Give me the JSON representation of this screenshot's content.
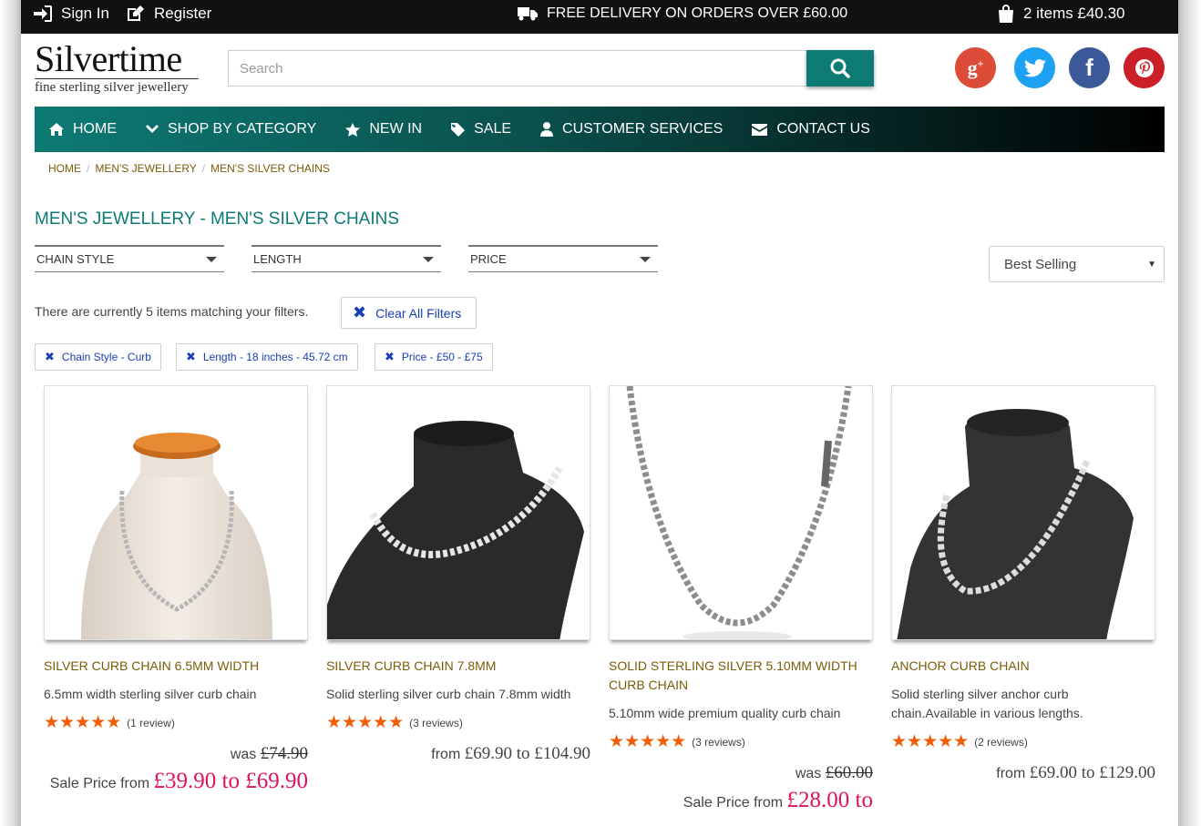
{
  "topbar": {
    "sign_in": "Sign In",
    "register": "Register",
    "delivery": "FREE DELIVERY ON ORDERS OVER £60.00",
    "cart": "2 items £40.30"
  },
  "header": {
    "brand": "Silvertime",
    "tagline": "fine sterling silver jewellery",
    "search_placeholder": "Search"
  },
  "social": [
    "google-plus",
    "twitter",
    "facebook",
    "pinterest"
  ],
  "nav": [
    {
      "label": "HOME",
      "icon": "home-icon"
    },
    {
      "label": "SHOP BY CATEGORY",
      "icon": "chevron-down-icon"
    },
    {
      "label": "NEW IN",
      "icon": "star-icon"
    },
    {
      "label": "SALE",
      "icon": "tag-icon"
    },
    {
      "label": "CUSTOMER SERVICES",
      "icon": "user-icon"
    },
    {
      "label": "CONTACT US",
      "icon": "envelope-icon"
    }
  ],
  "breadcrumb": [
    "HOME",
    "MEN'S JEWELLERY",
    "MEN'S SILVER CHAINS"
  ],
  "page_title": "MEN'S JEWELLERY - MEN'S SILVER CHAINS",
  "filters": [
    "CHAIN STYLE",
    "LENGTH",
    "PRICE"
  ],
  "sort": {
    "selected": "Best Selling"
  },
  "match_text": "There are currently 5 items matching your filters.",
  "clear_all": "Clear All Filters",
  "active_filters": [
    "Chain Style - Curb",
    "Length - 18 inches - 45.72 cm",
    "Price - £50 - £75"
  ],
  "products": [
    {
      "name": "SILVER CURB CHAIN 6.5MM WIDTH",
      "desc": "6.5mm width sterling silver curb chain",
      "stars": 5,
      "reviews": "(1 review)",
      "was_label": "was",
      "was": "£74.90",
      "sale_label": "Sale Price from",
      "sale": "£39.90 to £69.90"
    },
    {
      "name": "SILVER CURB CHAIN 7.8MM",
      "desc": "Solid sterling silver curb chain 7.8mm width",
      "stars": 5,
      "reviews": "(3 reviews)",
      "from_label": "from",
      "range": "£69.90 to £104.90"
    },
    {
      "name": "SOLID STERLING SILVER 5.10MM WIDTH CURB CHAIN",
      "desc": "5.10mm wide premium quality curb chain",
      "stars": 5,
      "reviews": "(3 reviews)",
      "was_label": "was",
      "was": "£60.00",
      "sale_label": "Sale Price from",
      "sale": "£28.00 to"
    },
    {
      "name": "ANCHOR CURB CHAIN",
      "desc": "Solid sterling silver anchor curb chain.Available in various lengths.",
      "stars": 5,
      "reviews": "(2 reviews)",
      "from_label": "from",
      "range": "£69.00 to £129.00"
    }
  ],
  "colors": {
    "accent": "#0d7a74",
    "gold_text": "#7a5c08",
    "sale_pink": "#e0115f",
    "star_orange": "#f25c05",
    "filter_blue": "#1a3fb5"
  }
}
